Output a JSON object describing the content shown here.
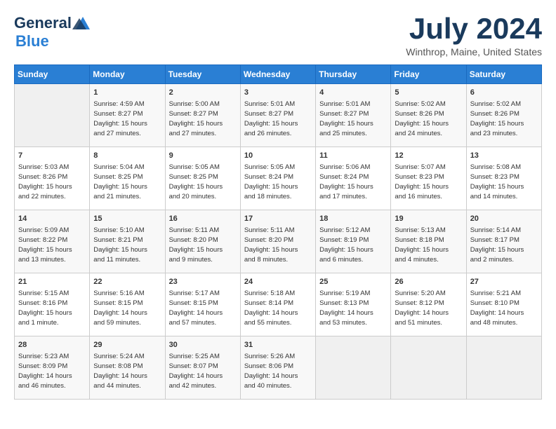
{
  "header": {
    "logo_general": "General",
    "logo_blue": "Blue",
    "month": "July 2024",
    "location": "Winthrop, Maine, United States"
  },
  "weekdays": [
    "Sunday",
    "Monday",
    "Tuesday",
    "Wednesday",
    "Thursday",
    "Friday",
    "Saturday"
  ],
  "weeks": [
    [
      {
        "day": "",
        "info": ""
      },
      {
        "day": "1",
        "info": "Sunrise: 4:59 AM\nSunset: 8:27 PM\nDaylight: 15 hours\nand 27 minutes."
      },
      {
        "day": "2",
        "info": "Sunrise: 5:00 AM\nSunset: 8:27 PM\nDaylight: 15 hours\nand 27 minutes."
      },
      {
        "day": "3",
        "info": "Sunrise: 5:01 AM\nSunset: 8:27 PM\nDaylight: 15 hours\nand 26 minutes."
      },
      {
        "day": "4",
        "info": "Sunrise: 5:01 AM\nSunset: 8:27 PM\nDaylight: 15 hours\nand 25 minutes."
      },
      {
        "day": "5",
        "info": "Sunrise: 5:02 AM\nSunset: 8:26 PM\nDaylight: 15 hours\nand 24 minutes."
      },
      {
        "day": "6",
        "info": "Sunrise: 5:02 AM\nSunset: 8:26 PM\nDaylight: 15 hours\nand 23 minutes."
      }
    ],
    [
      {
        "day": "7",
        "info": "Sunrise: 5:03 AM\nSunset: 8:26 PM\nDaylight: 15 hours\nand 22 minutes."
      },
      {
        "day": "8",
        "info": "Sunrise: 5:04 AM\nSunset: 8:25 PM\nDaylight: 15 hours\nand 21 minutes."
      },
      {
        "day": "9",
        "info": "Sunrise: 5:05 AM\nSunset: 8:25 PM\nDaylight: 15 hours\nand 20 minutes."
      },
      {
        "day": "10",
        "info": "Sunrise: 5:05 AM\nSunset: 8:24 PM\nDaylight: 15 hours\nand 18 minutes."
      },
      {
        "day": "11",
        "info": "Sunrise: 5:06 AM\nSunset: 8:24 PM\nDaylight: 15 hours\nand 17 minutes."
      },
      {
        "day": "12",
        "info": "Sunrise: 5:07 AM\nSunset: 8:23 PM\nDaylight: 15 hours\nand 16 minutes."
      },
      {
        "day": "13",
        "info": "Sunrise: 5:08 AM\nSunset: 8:23 PM\nDaylight: 15 hours\nand 14 minutes."
      }
    ],
    [
      {
        "day": "14",
        "info": "Sunrise: 5:09 AM\nSunset: 8:22 PM\nDaylight: 15 hours\nand 13 minutes."
      },
      {
        "day": "15",
        "info": "Sunrise: 5:10 AM\nSunset: 8:21 PM\nDaylight: 15 hours\nand 11 minutes."
      },
      {
        "day": "16",
        "info": "Sunrise: 5:11 AM\nSunset: 8:20 PM\nDaylight: 15 hours\nand 9 minutes."
      },
      {
        "day": "17",
        "info": "Sunrise: 5:11 AM\nSunset: 8:20 PM\nDaylight: 15 hours\nand 8 minutes."
      },
      {
        "day": "18",
        "info": "Sunrise: 5:12 AM\nSunset: 8:19 PM\nDaylight: 15 hours\nand 6 minutes."
      },
      {
        "day": "19",
        "info": "Sunrise: 5:13 AM\nSunset: 8:18 PM\nDaylight: 15 hours\nand 4 minutes."
      },
      {
        "day": "20",
        "info": "Sunrise: 5:14 AM\nSunset: 8:17 PM\nDaylight: 15 hours\nand 2 minutes."
      }
    ],
    [
      {
        "day": "21",
        "info": "Sunrise: 5:15 AM\nSunset: 8:16 PM\nDaylight: 15 hours\nand 1 minute."
      },
      {
        "day": "22",
        "info": "Sunrise: 5:16 AM\nSunset: 8:15 PM\nDaylight: 14 hours\nand 59 minutes."
      },
      {
        "day": "23",
        "info": "Sunrise: 5:17 AM\nSunset: 8:15 PM\nDaylight: 14 hours\nand 57 minutes."
      },
      {
        "day": "24",
        "info": "Sunrise: 5:18 AM\nSunset: 8:14 PM\nDaylight: 14 hours\nand 55 minutes."
      },
      {
        "day": "25",
        "info": "Sunrise: 5:19 AM\nSunset: 8:13 PM\nDaylight: 14 hours\nand 53 minutes."
      },
      {
        "day": "26",
        "info": "Sunrise: 5:20 AM\nSunset: 8:12 PM\nDaylight: 14 hours\nand 51 minutes."
      },
      {
        "day": "27",
        "info": "Sunrise: 5:21 AM\nSunset: 8:10 PM\nDaylight: 14 hours\nand 48 minutes."
      }
    ],
    [
      {
        "day": "28",
        "info": "Sunrise: 5:23 AM\nSunset: 8:09 PM\nDaylight: 14 hours\nand 46 minutes."
      },
      {
        "day": "29",
        "info": "Sunrise: 5:24 AM\nSunset: 8:08 PM\nDaylight: 14 hours\nand 44 minutes."
      },
      {
        "day": "30",
        "info": "Sunrise: 5:25 AM\nSunset: 8:07 PM\nDaylight: 14 hours\nand 42 minutes."
      },
      {
        "day": "31",
        "info": "Sunrise: 5:26 AM\nSunset: 8:06 PM\nDaylight: 14 hours\nand 40 minutes."
      },
      {
        "day": "",
        "info": ""
      },
      {
        "day": "",
        "info": ""
      },
      {
        "day": "",
        "info": ""
      }
    ]
  ]
}
